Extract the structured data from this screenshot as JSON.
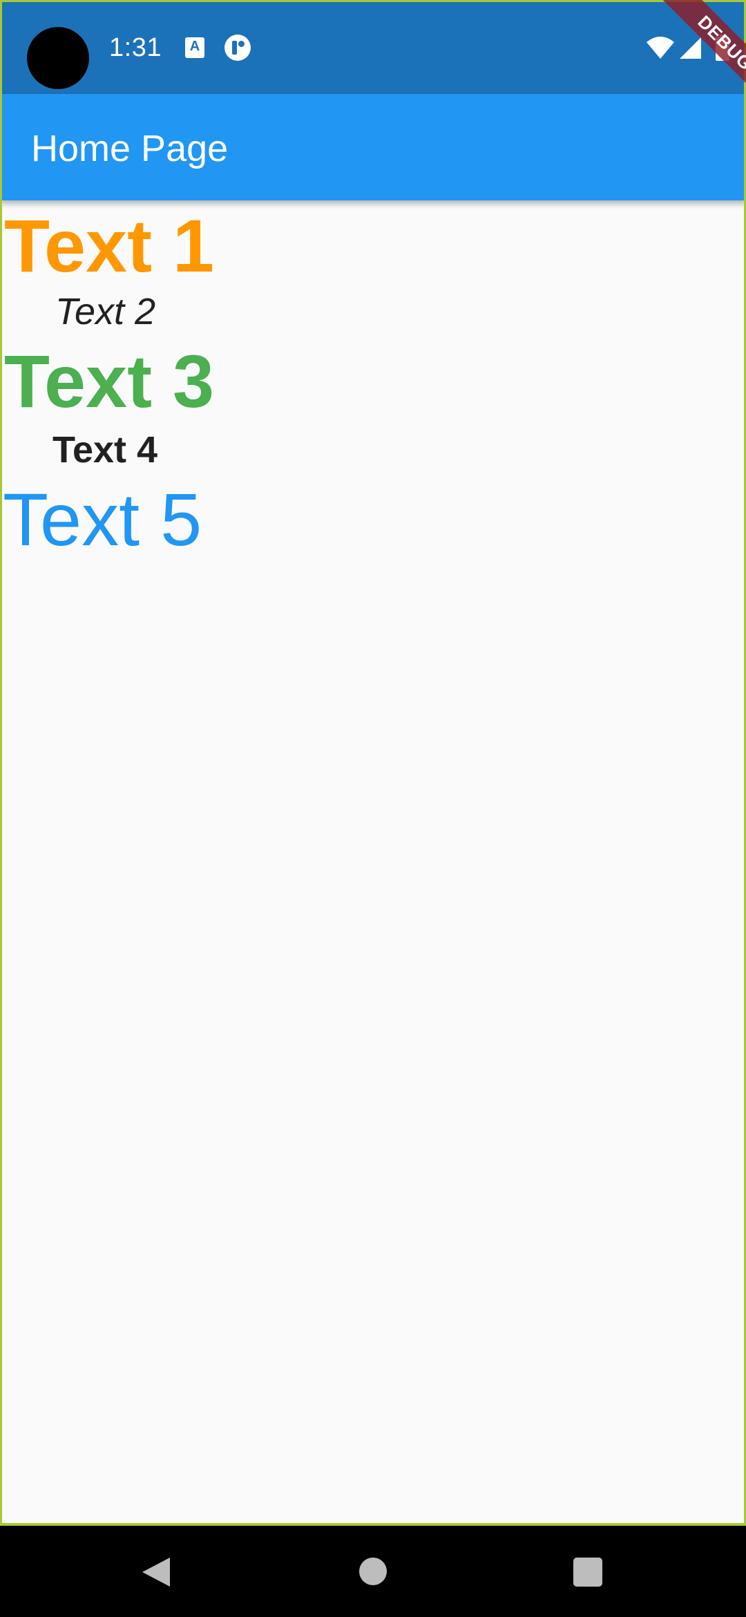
{
  "status_bar": {
    "time": "1:31",
    "notification_icons": [
      "translate-icon",
      "app-notification-icon"
    ],
    "system_icons": [
      "wifi-icon",
      "signal-icon",
      "battery-icon"
    ],
    "background_color": "#1C72B8"
  },
  "debug_banner": {
    "label": "DEBUG"
  },
  "app_bar": {
    "title": "Home Page",
    "background_color": "#2196F3"
  },
  "texts": [
    {
      "label": "Text 1",
      "color": "#FF9800",
      "style": "bold"
    },
    {
      "label": "Text 2",
      "color": "#212121",
      "style": "italic"
    },
    {
      "label": "Text 3",
      "color": "#4CAF50",
      "style": "bold"
    },
    {
      "label": "Text 4",
      "color": "#212121",
      "style": "bold"
    },
    {
      "label": "Text 5",
      "color": "#2196F3",
      "style": "regular"
    }
  ],
  "navigation_bar": {
    "buttons": [
      "back-icon",
      "home-icon",
      "recents-icon"
    ]
  }
}
